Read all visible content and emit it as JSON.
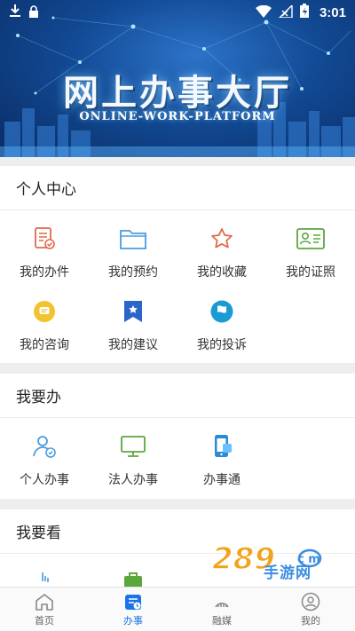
{
  "status_bar": {
    "time": "3:01"
  },
  "banner": {
    "title": "网上办事大厅",
    "subtitle": "ONLINE-WORK-PLATFORM"
  },
  "personal_center": {
    "title": "个人中心",
    "items": [
      {
        "label": "我的办件",
        "icon": "document-check-icon"
      },
      {
        "label": "我的预约",
        "icon": "folder-icon"
      },
      {
        "label": "我的收藏",
        "icon": "star-icon"
      },
      {
        "label": "我的证照",
        "icon": "id-card-icon"
      },
      {
        "label": "我的咨询",
        "icon": "chat-bubble-icon"
      },
      {
        "label": "我的建议",
        "icon": "bookmark-icon"
      },
      {
        "label": "我的投诉",
        "icon": "flag-icon"
      }
    ]
  },
  "to_do": {
    "title": "我要办",
    "items": [
      {
        "label": "个人办事",
        "icon": "person-icon"
      },
      {
        "label": "法人办事",
        "icon": "monitor-icon"
      },
      {
        "label": "办事通",
        "icon": "phone-app-icon"
      }
    ]
  },
  "to_see": {
    "title": "我要看"
  },
  "bottom_nav": {
    "items": [
      {
        "label": "首页",
        "icon": "home-icon"
      },
      {
        "label": "办事",
        "icon": "work-calendar-icon"
      },
      {
        "label": "融媒",
        "icon": "media-icon"
      },
      {
        "label": "我的",
        "icon": "user-icon"
      }
    ],
    "active_index": 1
  },
  "watermark": {
    "text": "手游网",
    "brand": "289"
  },
  "colors": {
    "accent": "#1a73e8",
    "banner": "#124a94",
    "orange": "#e8a33a",
    "green": "#5aa83d",
    "red": "#d9534f"
  }
}
